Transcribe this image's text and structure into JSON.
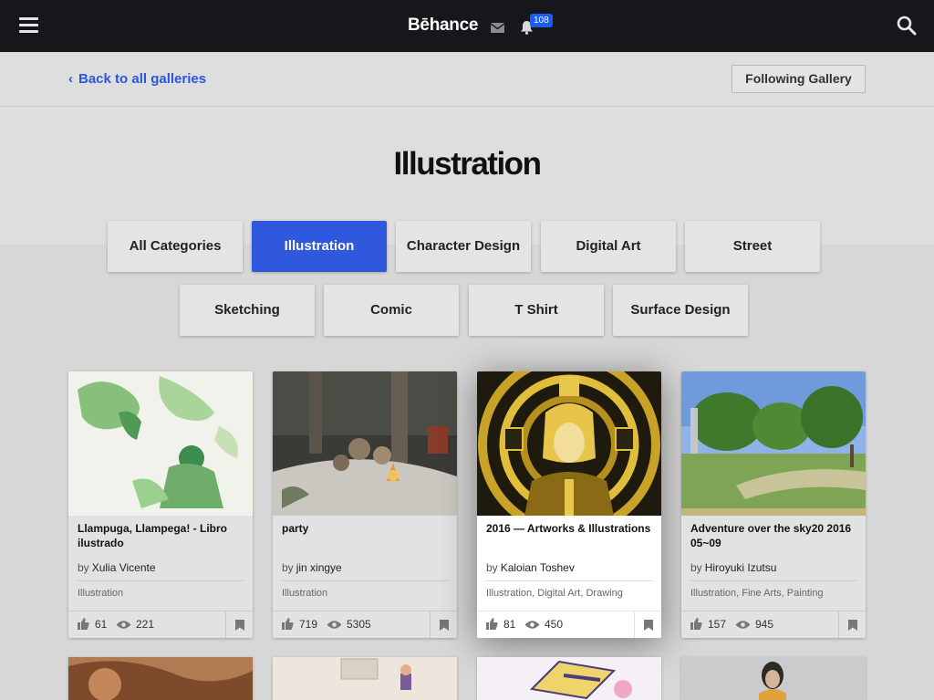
{
  "topbar": {
    "brand": "Bēhance",
    "notification_count": "108",
    "icons": [
      "menu-icon",
      "mail-icon",
      "bell-icon",
      "search-icon"
    ]
  },
  "header": {
    "back_label": "Back to all galleries",
    "follow_label": "Following Gallery",
    "title": "Illustration"
  },
  "categories": [
    {
      "label": "All Categories",
      "active": false
    },
    {
      "label": "Illustration",
      "active": true
    },
    {
      "label": "Character Design",
      "active": false
    },
    {
      "label": "Digital Art",
      "active": false
    },
    {
      "label": "Street",
      "active": false
    },
    {
      "label": "Sketching",
      "active": false
    },
    {
      "label": "Comic",
      "active": false
    },
    {
      "label": "T Shirt",
      "active": false
    },
    {
      "label": "Surface Design",
      "active": false
    }
  ],
  "projects": [
    {
      "title": "Llampuga, Llampega! - Libro ilustrado",
      "by": "by",
      "owner": "Xulia Vicente",
      "fields": [
        "Illustration"
      ],
      "likes": "61",
      "views": "221"
    },
    {
      "title": "party",
      "by": "by",
      "owner": "jin xingye",
      "fields": [
        "Illustration"
      ],
      "likes": "719",
      "views": "5305"
    },
    {
      "title": "2016 — Artworks & Illustrations",
      "by": "by",
      "owner": "Kaloian Toshev",
      "fields": [
        "Illustration",
        "Digital Art",
        "Drawing"
      ],
      "likes": "81",
      "views": "450"
    },
    {
      "title": "Adventure over the sky20 2016 05~09",
      "by": "by",
      "owner": "Hiroyuki Izutsu",
      "fields": [
        "Illustration",
        "Fine Arts",
        "Painting"
      ],
      "likes": "157",
      "views": "945"
    }
  ],
  "colors": {
    "accent": "#2f58dd",
    "link": "#2a56e0",
    "topbar": "#16171b",
    "badge": "#1b5cf5"
  }
}
